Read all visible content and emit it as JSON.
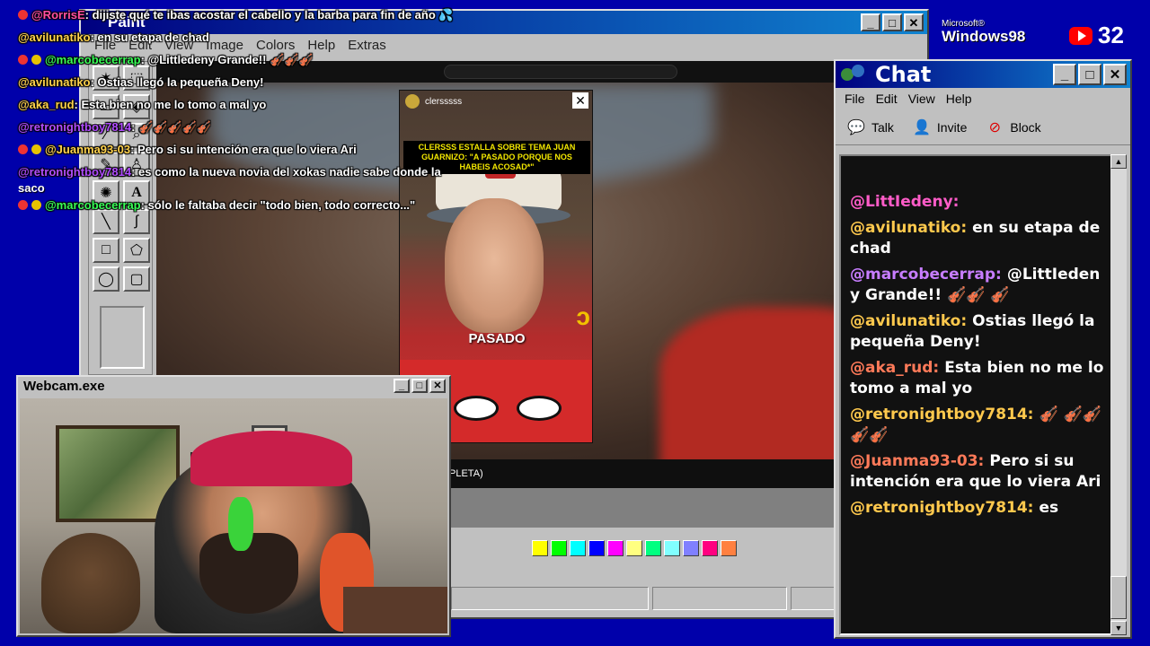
{
  "paint": {
    "title": "Paint",
    "menu": [
      "File",
      "Edit",
      "View",
      "Image",
      "Colors",
      "Help",
      "Extras"
    ],
    "video_caption_fragment": "PLETA)"
  },
  "reel": {
    "username": "clersssss",
    "headline": "CLERSSS ESTALLA SOBRE TEMA JUAN GUARNIZO: \"A PASADO PORQUE NOS HABEIS ACOSAD*\"",
    "caption": "PASADO"
  },
  "overlay_chat": [
    {
      "user": "@RorrisE",
      "text": ": dijiste qué te ibas acostar el cabello y la barba para fin de año 💦",
      "color": "#ff4fa3",
      "icons": 1
    },
    {
      "user": "@avilunatiko",
      "text": ": en su etapa de chad",
      "color": "#ffd24d",
      "icons": 0
    },
    {
      "user": "@marcobecerrap",
      "text": ": @Littledeny Grande!! 🎻🎻🎻",
      "color": "#39ff57",
      "icons": 2
    },
    {
      "user": "@avilunatiko",
      "text": ": Ostias llegó la pequeña Deny!",
      "color": "#ffd24d",
      "icons": 0
    },
    {
      "user": "@aka_rud",
      "text": ": Esta bien no me lo tomo a mal yo",
      "color": "#ffd24d",
      "icons": 0
    },
    {
      "user": "@retronightboy7814",
      "text": ": 🎻🎻🎻🎻🎻",
      "color": "#b24dff",
      "icons": 0
    },
    {
      "user": "@Juanma93-03",
      "text": ": Pero si su intención era que lo viera Ari",
      "color": "#ffd24d",
      "icons": 2
    },
    {
      "user": "@retronightboy7814",
      "text": ": es como la nueva novia del xokas nadie sabe donde la",
      "color": "#b24dff",
      "icons": 0
    },
    {
      "user": "",
      "text": "saco",
      "color": "#ffffff",
      "icons": 0
    },
    {
      "user": "@marcobecerrap",
      "text": ": sólo le faltaba decir \"todo bien, todo correcto...\"",
      "color": "#39ff57",
      "icons": 2
    }
  ],
  "webcam": {
    "title": "Webcam.exe"
  },
  "chat": {
    "title": "Chat",
    "menu": [
      "File",
      "Edit",
      "View",
      "Help"
    ],
    "tools": [
      {
        "label": "Talk",
        "icon": "talk-icon"
      },
      {
        "label": "Invite",
        "icon": "invite-icon"
      },
      {
        "label": "Block",
        "icon": "block-icon"
      }
    ],
    "messages": [
      {
        "user": "@LittIedeny:",
        "text": "",
        "color": "#ff5cc8"
      },
      {
        "user": "@avilunatiko:",
        "text": "en su etapa de chad",
        "color": "#ffc94d"
      },
      {
        "user": "@marcobecerrap:",
        "text": "@LittIedeny Grande!! 🎻🎻 🎻",
        "color": "#c77dff"
      },
      {
        "user": "@avilunatiko:",
        "text": "Ostias llegó la pequeña Deny!",
        "color": "#ffc94d"
      },
      {
        "user": "@aka_rud:",
        "text": "Esta bien no me lo tomo a mal yo",
        "color": "#ff7a59"
      },
      {
        "user": "@retronightboy7814:",
        "text": "🎻 🎻🎻🎻🎻",
        "color": "#ffc94d"
      },
      {
        "user": "@Juanma93-03:",
        "text": "Pero si su intención era que lo viera Ari",
        "color": "#ff7a59"
      },
      {
        "user": "@retronightboy7814:",
        "text": "es",
        "color": "#ffc94d"
      }
    ]
  },
  "branding": {
    "microsoft": "Microsoft®",
    "windows": "Windows98",
    "viewers": "32"
  },
  "palette": [
    "#ffff00",
    "#00ff00",
    "#00ffff",
    "#0000ff",
    "#ff00ff",
    "#ffff80",
    "#00ff80",
    "#80ffff",
    "#8080ff",
    "#ff0080",
    "#ff8040"
  ]
}
